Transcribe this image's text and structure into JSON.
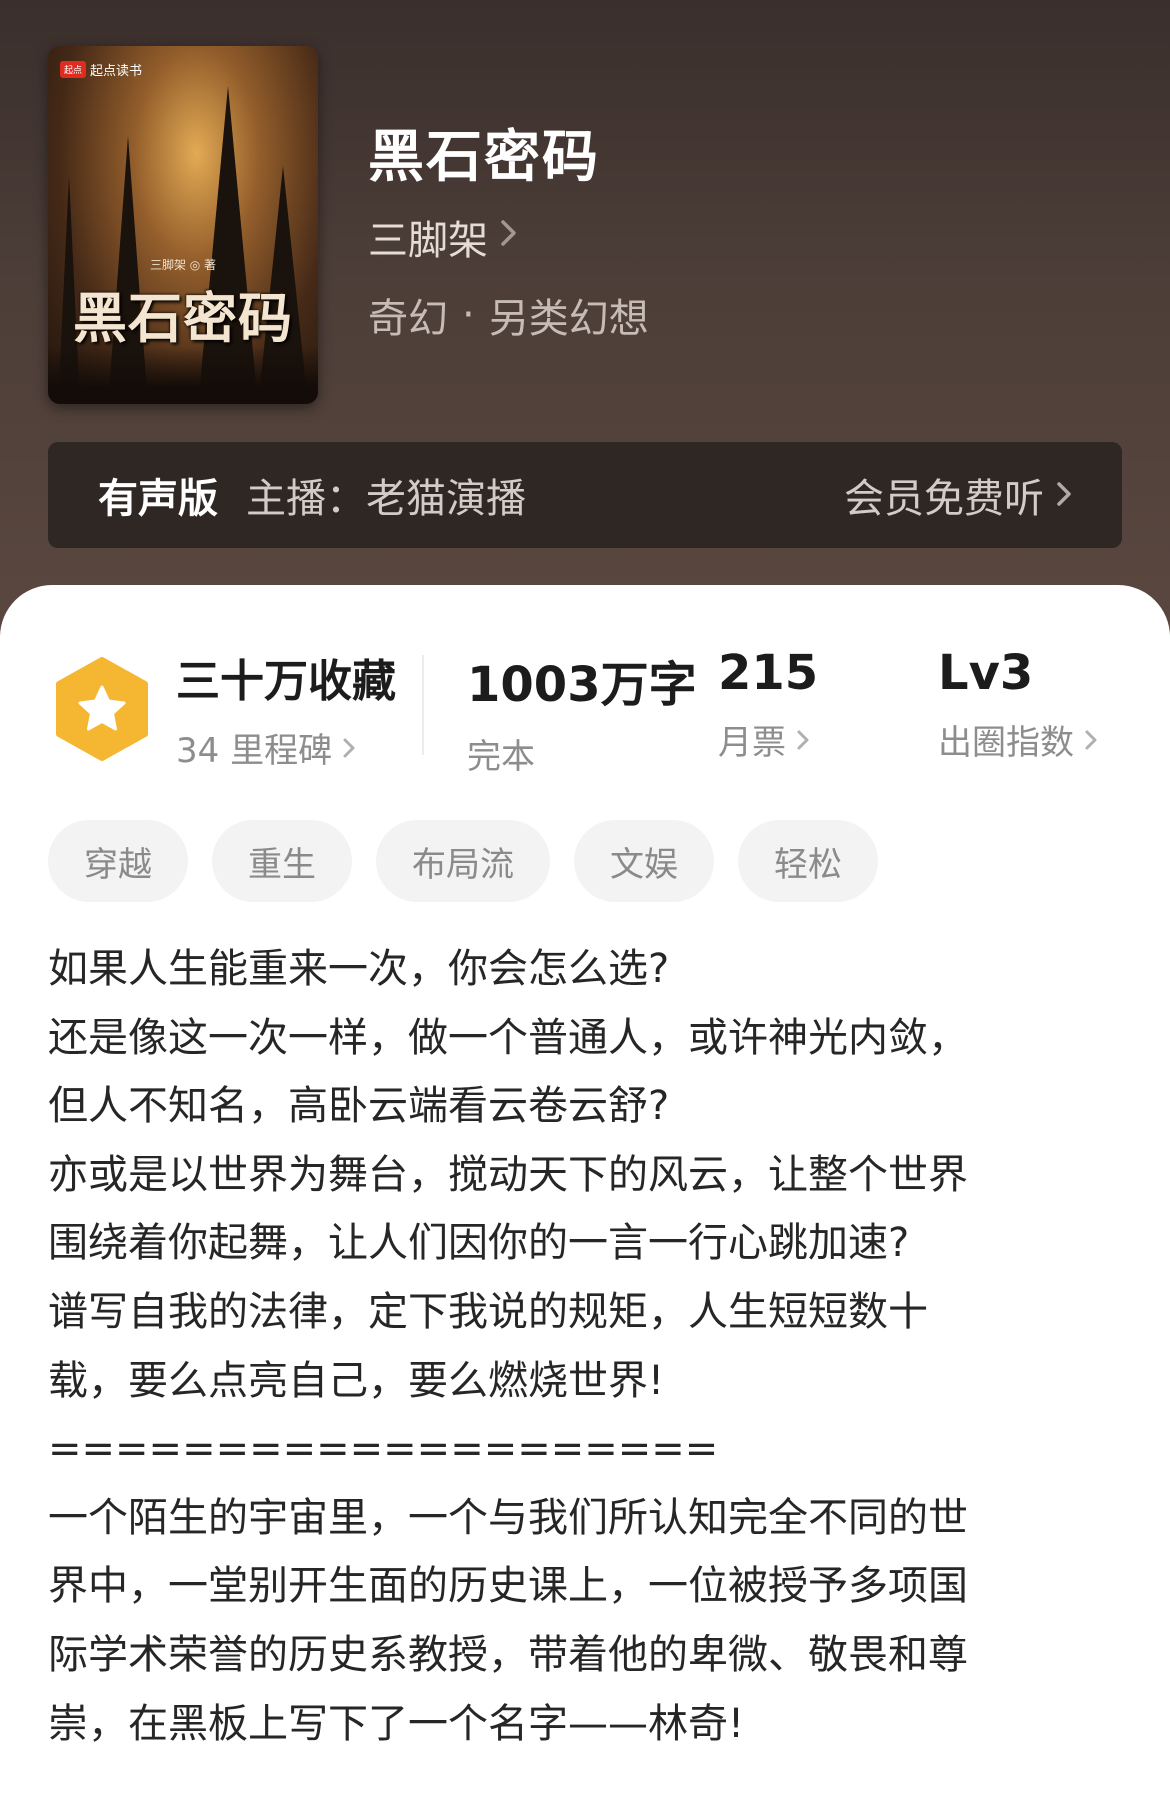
{
  "book": {
    "title": "黑石密码",
    "author": "三脚架",
    "genre": "奇幻",
    "subgenre": "另类幻想",
    "genre_sep": "·",
    "cover": {
      "publisher": "起点读书",
      "publisher_logo": "起点",
      "author_line": "三脚架 ◎ 著",
      "title_text": "黑石密码"
    }
  },
  "audio": {
    "label": "有声版",
    "host": "主播：老猫演播",
    "action": "会员免费听"
  },
  "stats": {
    "collect": {
      "main": "三十万收藏",
      "sub": "34 里程碑"
    },
    "words": {
      "main": "1003万字",
      "sub": "完本"
    },
    "tickets": {
      "main": "215",
      "sub": "月票"
    },
    "index": {
      "main": "Lv3",
      "sub": "出圈指数"
    }
  },
  "tags": [
    "穿越",
    "重生",
    "布局流",
    "文娱",
    "轻松"
  ],
  "description": [
    "如果人生能重来一次，你会怎么选?",
    "还是像这一次一样，做一个普通人，或许神光内敛，",
    "但人不知名，高卧云端看云卷云舒?",
    "亦或是以世界为舞台，搅动天下的风云，让整个世界",
    "围绕着你起舞，让人们因你的一言一行心跳加速?",
    "谱写自我的法律，定下我说的规矩，人生短短数十",
    "载，要么点亮自己，要么燃烧世界!",
    "====================",
    "一个陌生的宇宙里，一个与我们所认知完全不同的世",
    "界中，一堂别开生面的历史课上，一位被授予多项国",
    "际学术荣誉的历史系教授，带着他的卑微、敬畏和尊",
    "崇，在黑板上写下了一个名字——林奇!"
  ],
  "colors": {
    "header_bg": "#4a3b35",
    "badge": "#f5b731",
    "text_main": "#1c1c1c",
    "text_sub": "#8d8d8d"
  },
  "icons": {
    "chevron": "chevron-right-icon",
    "badge": "star-badge-icon"
  }
}
